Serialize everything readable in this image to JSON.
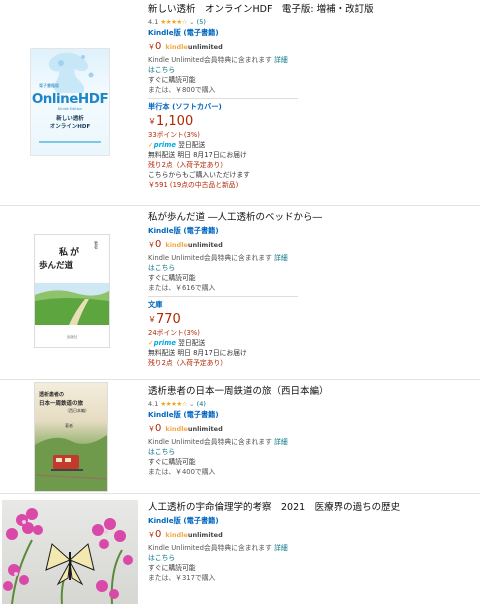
{
  "results": [
    {
      "title": "新しい透析　オンラインHDF　電子版: 増補・改訂版",
      "rating": {
        "score": "4.1",
        "stars": "★★★★☆",
        "count": "(5)"
      },
      "cover": {
        "brand": "OnlineHDF",
        "sub": "Kindle Edition",
        "t1": "新しい透析",
        "t2": "オンラインHDF",
        "badge": "電子書籍版"
      },
      "kindle": {
        "format": "Kindle版 (電子書籍)",
        "price": "0",
        "ku_brand": "kindle",
        "ku_word": "unlimited",
        "ku_text": "Kindle Unlimited会員特典に含まれます",
        "ku_link": "詳細",
        "ku_link2": "はこちら",
        "buy_now": "すぐに購読可能",
        "or_buy": "または、￥800で購入"
      },
      "print": {
        "format": "単行本 (ソフトカバー)",
        "price": "1,100",
        "points": "33ポイント(3%)",
        "prime_label": "prime",
        "prime_text": "翌日配送",
        "delivery": "無料配送 明日 8月17日にお届け",
        "stock": "残り2点（入荷予定あり）",
        "order_note": "こちらからもご購入いただけます",
        "used": "￥591 (19点の中古品と新品)"
      }
    },
    {
      "title": "私が歩んだ道 ―人工透析のベッドから―",
      "cover": {
        "t1": "私が",
        "t2": "歩んだ道",
        "author": "著者",
        "pub": "出版社"
      },
      "kindle": {
        "format": "Kindle版 (電子書籍)",
        "price": "0",
        "ku_brand": "kindle",
        "ku_word": "unlimited",
        "ku_text": "Kindle Unlimited会員特典に含まれます",
        "ku_link": "詳細",
        "ku_link2": "はこちら",
        "buy_now": "すぐに購読可能",
        "or_buy": "または、￥616で購入"
      },
      "print": {
        "format": "文庫",
        "price": "770",
        "points": "24ポイント(3%)",
        "prime_label": "prime",
        "prime_text": "翌日配送",
        "delivery": "無料配送 明日 8月17日にお届け",
        "stock": "残り2点（入荷予定あり）"
      }
    },
    {
      "title": "透析患者の日本一周鉄道の旅（西日本編）",
      "rating": {
        "score": "4.1",
        "stars": "★★★★☆",
        "count": "(4)"
      },
      "cover": {
        "t1": "透析患者の",
        "t2": "日本一周鉄道の旅",
        "t3": "（西日本編）",
        "author": "著者"
      },
      "kindle": {
        "format": "Kindle版 (電子書籍)",
        "price": "0",
        "ku_brand": "kindle",
        "ku_word": "unlimited",
        "ku_text": "Kindle Unlimited会員特典に含まれます",
        "ku_link": "詳細",
        "ku_link2": "はこちら",
        "buy_now": "すぐに購読可能",
        "or_buy": "または、￥400で購入"
      }
    },
    {
      "title": "人工透析の宇命倫理学的考察　2021　医療界の過ちの歴史",
      "kindle": {
        "format": "Kindle版 (電子書籍)",
        "price": "0",
        "ku_brand": "kindle",
        "ku_word": "unlimited",
        "ku_text": "Kindle Unlimited会員特典に含まれます",
        "ku_link": "詳細",
        "ku_link2": "はこちら",
        "buy_now": "すぐに購読可能",
        "or_buy": "または、￥317で購入"
      }
    }
  ]
}
